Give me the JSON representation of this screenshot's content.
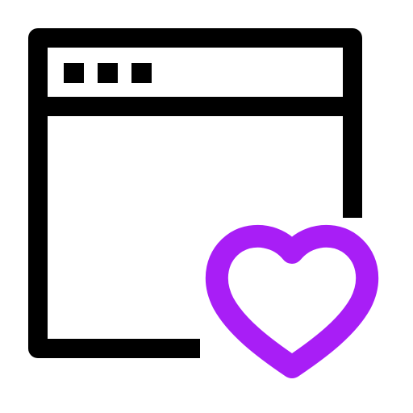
{
  "icon": {
    "name": "browser-window-heart-icon",
    "parts": {
      "window": "browser-window-icon",
      "heart": "heart-icon"
    }
  },
  "colors": {
    "background": "#ffffff",
    "stroke": "#000000",
    "accent": "#a81ef6"
  }
}
